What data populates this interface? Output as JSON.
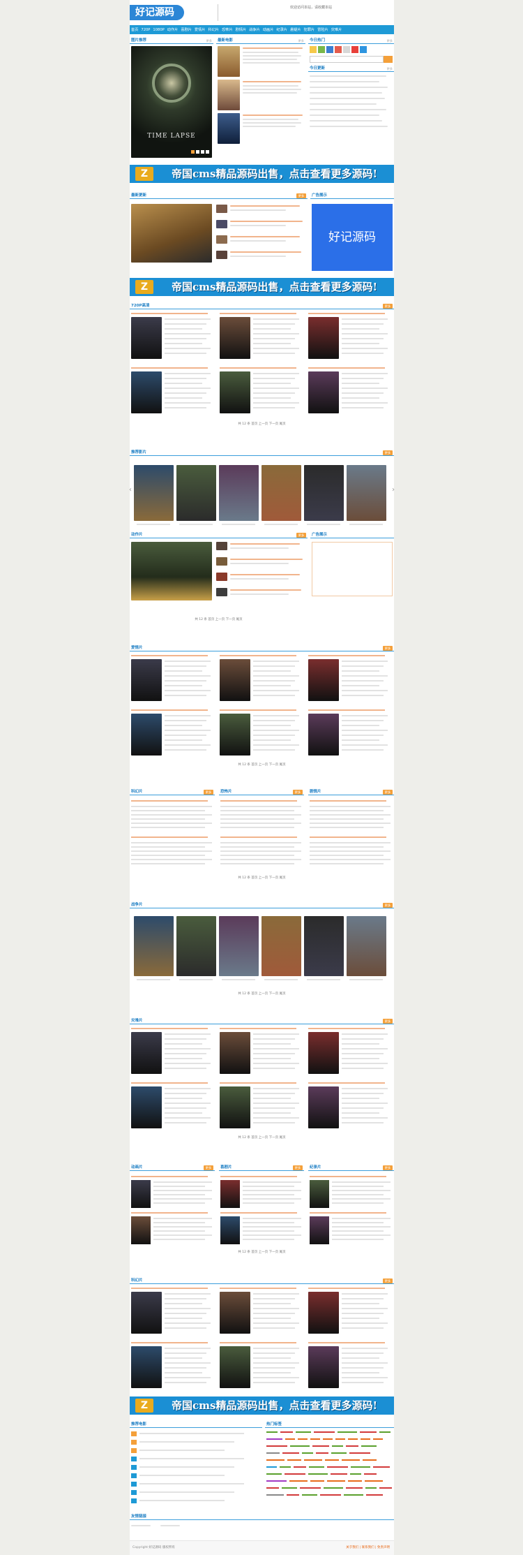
{
  "header": {
    "logo": "好记源码",
    "tip": "欢迎访问本站，请收藏本站"
  },
  "nav": [
    "首页",
    "720P",
    "1080P",
    "动作片",
    "喜剧片",
    "爱情片",
    "科幻片",
    "恐怖片",
    "剧情片",
    "战争片",
    "动画片",
    "纪录片",
    "悬疑片",
    "犯罪片",
    "冒险片",
    "灾难片"
  ],
  "sections": {
    "featured": "图片推荐",
    "latest": "最新电影",
    "hot": "今日更新",
    "weekly": "今日热门",
    "latest_update": "最新更新",
    "ad_title": "广告展示",
    "ad_text": "好记源码",
    "hd720": "720P高清",
    "hot_movies": "推荐影片",
    "adv_block": "广告展示",
    "action": "动作片",
    "love": "爱情片",
    "scifi": "科幻片",
    "horror": "恐怖片",
    "drama": "剧情片",
    "war": "战争片",
    "disaster": "灾难片",
    "anime": "动画片",
    "comedy": "喜剧片",
    "doc": "纪录片",
    "sci_bottom": "科幻片",
    "best": "推荐电影",
    "hot_tags": "热门标签",
    "friend_links": "友情链接"
  },
  "more_label": "更多",
  "featured_caption": "TIME LAPSE",
  "banner_text": "帝国cms精品源码出售，点击查看更多源码!",
  "pager_text": "共 12 条 首页 上一页 下一页 尾页",
  "footer": {
    "copyright": "Copyright 好记源码 版权所有",
    "links": "关于我们 | 联系我们 | 免责声明"
  },
  "colors": {
    "nav": "#1e9ad6",
    "accent": "#f4a03a",
    "banner": "#1b8fd4",
    "link_orange": "#e86b1a"
  }
}
